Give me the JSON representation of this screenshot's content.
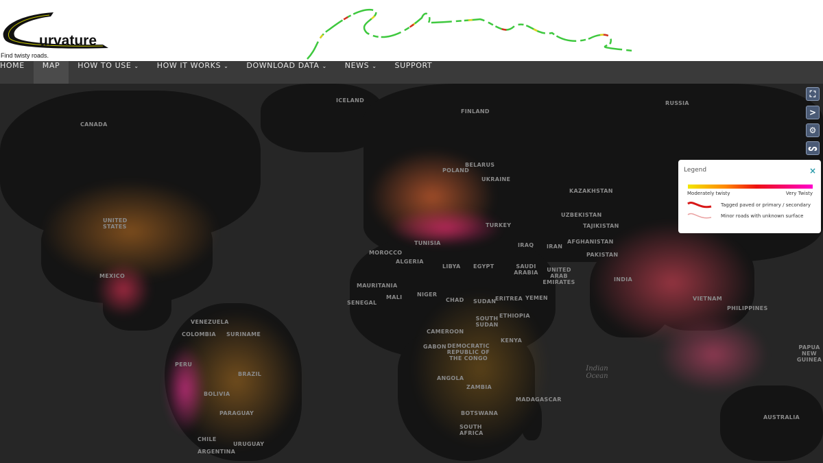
{
  "brand": {
    "name": "urvature",
    "tagline": "Find twisty roads."
  },
  "nav": {
    "items": [
      {
        "label": "HOME",
        "dropdown": false
      },
      {
        "label": "MAP",
        "dropdown": false,
        "active": true
      },
      {
        "label": "HOW TO USE",
        "dropdown": true
      },
      {
        "label": "HOW IT WORKS",
        "dropdown": true
      },
      {
        "label": "DOWNLOAD DATA",
        "dropdown": true
      },
      {
        "label": "NEWS",
        "dropdown": true
      },
      {
        "label": "SUPPORT",
        "dropdown": false
      }
    ],
    "chevron": "⌄"
  },
  "map_controls": [
    {
      "icon": "fullscreen-icon",
      "glyph": "⛶"
    },
    {
      "icon": "chevron-right-icon",
      "glyph": ">"
    },
    {
      "icon": "gear-icon",
      "glyph": "⚙"
    },
    {
      "icon": "route-icon",
      "glyph": "ᔕ"
    }
  ],
  "legend": {
    "title": "Legend",
    "close": "×",
    "low": "Moderately twisty",
    "high": "Very Twisty",
    "items": [
      {
        "label": "Tagged paved or primary / secondary",
        "color": "#d81818"
      },
      {
        "label": "Minor roads with unknown surface",
        "color": "#eaa0a0"
      }
    ]
  },
  "map": {
    "labels": [
      "CANADA",
      "UNITED STATES",
      "MEXICO",
      "ICELAND",
      "FINLAND",
      "RUSSIA",
      "POLAND",
      "BELARUS",
      "UKRAINE",
      "KAZAKHSTAN",
      "UZBEKISTAN",
      "TAJIKISTAN",
      "AFGHANISTAN",
      "PAKISTAN",
      "IRAN",
      "IRAQ",
      "TURKEY",
      "SAUDI ARABIA",
      "UNITED ARAB EMIRATES",
      "YEMEN",
      "EGYPT",
      "LIBYA",
      "ALGERIA",
      "TUNISIA",
      "MOROCCO",
      "MAURITANIA",
      "MALI",
      "NIGER",
      "CHAD",
      "SUDAN",
      "ERITREA",
      "ETHIOPIA",
      "SOUTH SUDAN",
      "SENEGAL",
      "CAMEROON",
      "GABON",
      "DEMOCRATIC REPUBLIC OF THE CONGO",
      "KENYA",
      "ANGOLA",
      "ZAMBIA",
      "BOTSWANA",
      "SOUTH AFRICA",
      "MADAGASCAR",
      "INDIA",
      "VIETNAM",
      "PHILIPPINES",
      "PAPUA NEW GUINEA",
      "AUSTRALIA",
      "VENEZUELA",
      "SURINAME",
      "COLOMBIA",
      "PERU",
      "BRAZIL",
      "BOLIVIA",
      "PARAGUAY",
      "CHILE",
      "ARGENTINA",
      "URUGUAY"
    ],
    "oceans": [
      "Indian Ocean"
    ]
  },
  "colors": {
    "nav_bg": "#3a3a3a",
    "map_ocean": "#262626",
    "map_land": "#141414",
    "accent": "#4a5a75"
  }
}
